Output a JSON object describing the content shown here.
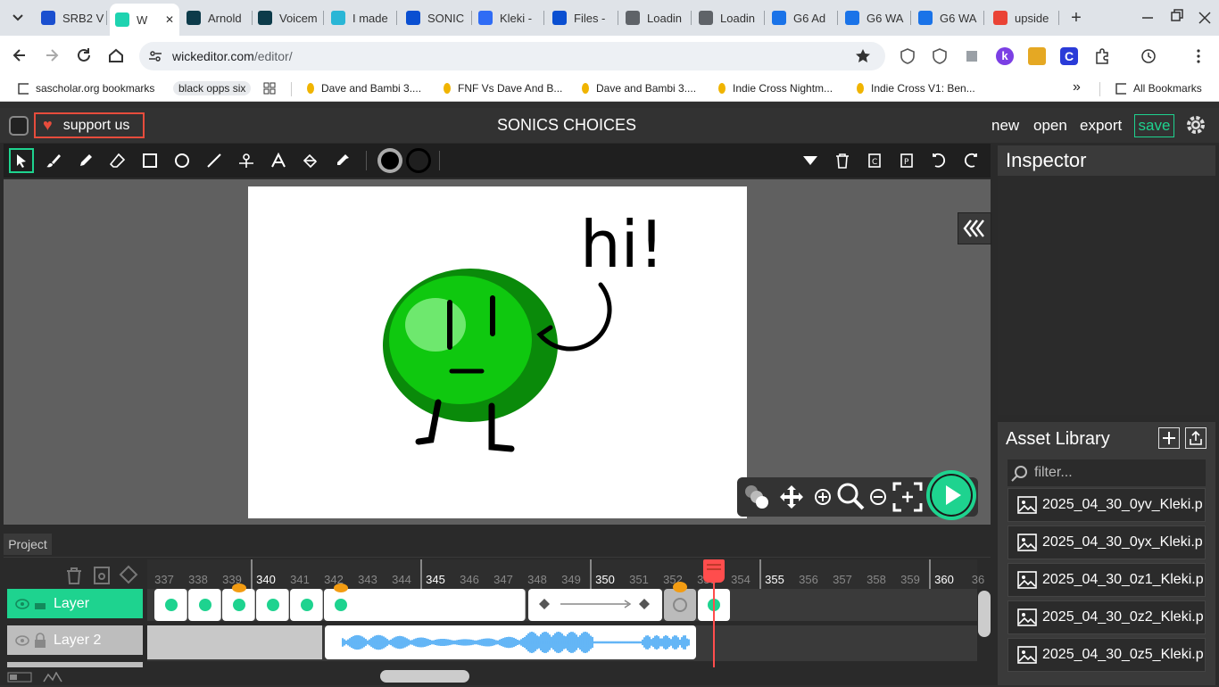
{
  "browser": {
    "tabs": [
      {
        "title": "SRB2 V",
        "color": "#1a4fcf"
      },
      {
        "title": "W",
        "color": "#1ed3b0",
        "active": true
      },
      {
        "title": "Arnold",
        "color": "#0d3b4a"
      },
      {
        "title": "Voicem",
        "color": "#0d3b4a"
      },
      {
        "title": "I made",
        "color": "#29b6d6"
      },
      {
        "title": "SONIC",
        "color": "#0a4fd1"
      },
      {
        "title": "Kleki -",
        "color": "#2f6cf5"
      },
      {
        "title": "Files -",
        "color": "#0a4fd1"
      },
      {
        "title": "Loadin",
        "color": "#5f6368"
      },
      {
        "title": "Loadin",
        "color": "#5f6368"
      },
      {
        "title": "G6 Ad",
        "color": "#1a73e8"
      },
      {
        "title": "G6 WA",
        "color": "#1a73e8"
      },
      {
        "title": "G6 WA",
        "color": "#1a73e8"
      },
      {
        "title": "upside",
        "color": "#ea4335"
      }
    ],
    "url_domain": "wickeditor.com",
    "url_path": "/editor/",
    "bookmarks": [
      "sascholar.org bookmarks",
      "black opps six",
      "Dave and Bambi 3....",
      "FNF Vs Dave And B...",
      "Dave and Bambi 3....",
      "Indie Cross Nightm...",
      "Indie Cross V1: Ben..."
    ],
    "all_bookmarks": "All Bookmarks"
  },
  "app": {
    "support_label": "support us",
    "project_title": "SONICS CHOICES",
    "menu": {
      "new": "new",
      "open": "open",
      "export": "export",
      "save": "save"
    },
    "inspector_title": "Inspector",
    "asset_library_title": "Asset Library",
    "filter_placeholder": "filter...",
    "assets": [
      "2025_04_30_0yv_Kleki.p",
      "2025_04_30_0yx_Kleki.p",
      "2025_04_30_0z1_Kleki.p",
      "2025_04_30_0z2_Kleki.p",
      "2025_04_30_0z5_Kleki.p"
    ],
    "stage_text": "hi!",
    "timeline": {
      "tab": "Project",
      "layers": [
        "Layer",
        "Layer 2"
      ],
      "frames": [
        "337",
        "338",
        "339",
        "340",
        "341",
        "342",
        "343",
        "344",
        "345",
        "346",
        "347",
        "348",
        "349",
        "350",
        "351",
        "352",
        "353",
        "354",
        "355",
        "356",
        "357",
        "358",
        "359",
        "360",
        "36"
      ],
      "playhead_frame": 353
    },
    "colors": {
      "accent": "#1ed38f",
      "support": "#e74c3c",
      "playhead": "#ff4d4d"
    }
  }
}
